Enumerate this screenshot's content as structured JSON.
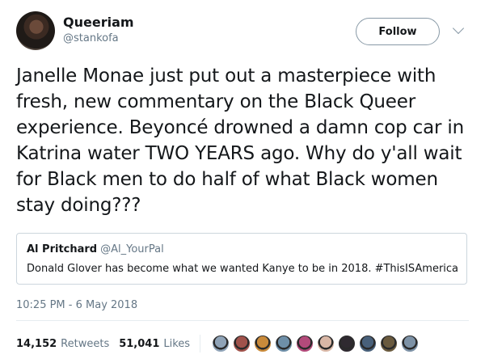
{
  "author": {
    "name": "Queeriam",
    "handle": "@stankofa"
  },
  "follow_label": "Follow",
  "tweet_text": "Janelle Monae just put out a masterpiece with fresh, new commentary on the Black Queer experience. Beyoncé drowned a damn cop car in Katrina water TWO YEARS ago. Why do y'all wait for Black men to do half of what Black women stay doing???",
  "quoted_tweet": {
    "name": "Al Pritchard",
    "handle": "@Al_YourPal",
    "text": "Donald Glover has become what we wanted Kanye to be in 2018. #ThisISAmerica"
  },
  "timestamp": "10:25 PM - 6 May 2018",
  "stats": {
    "retweets_count": "14,152",
    "retweets_label": "Retweets",
    "likes_count": "51,041",
    "likes_label": "Likes"
  },
  "likers_colors": [
    "#8fa3b7",
    "#a0524b",
    "#c98a3a",
    "#6e8fa8",
    "#b34a7a",
    "#d9b7a6",
    "#2f2a30",
    "#48607a",
    "#6a5a3e",
    "#7d92a6"
  ]
}
